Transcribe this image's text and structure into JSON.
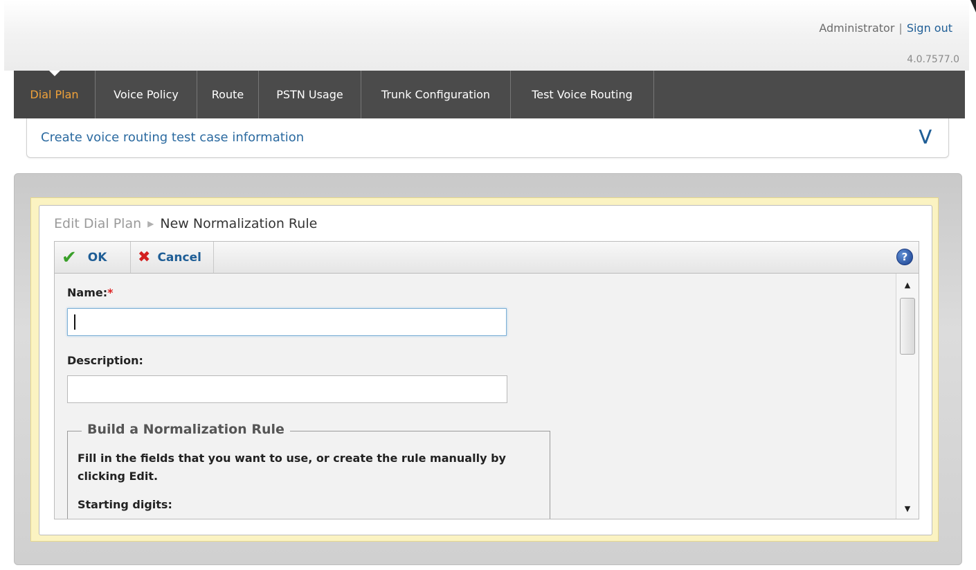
{
  "header": {
    "user": "Administrator",
    "separator": "|",
    "sign_out": "Sign out",
    "version": "4.0.7577.0"
  },
  "nav": {
    "tabs": [
      {
        "label": "Dial Plan",
        "active": true
      },
      {
        "label": "Voice Policy",
        "active": false
      },
      {
        "label": "Route",
        "active": false
      },
      {
        "label": "PSTN Usage",
        "active": false
      },
      {
        "label": "Trunk Configuration",
        "active": false
      },
      {
        "label": "Test Voice Routing",
        "active": false
      }
    ]
  },
  "infobar": {
    "text": "Create voice routing test case information",
    "expand_icon": "double-chevron-down-icon"
  },
  "breadcrumb": {
    "parent": "Edit Dial Plan",
    "current": "New Normalization Rule"
  },
  "toolbar": {
    "ok_label": "OK",
    "cancel_label": "Cancel",
    "help_icon": "help-icon"
  },
  "form": {
    "name_label": "Name:",
    "name_required": "*",
    "name_value": "",
    "description_label": "Description:",
    "description_value": "",
    "build_title": "Build a Normalization Rule",
    "build_desc": "Fill in the fields that you want to use, or create the rule manually by clicking Edit.",
    "starting_digits_label": "Starting digits:"
  },
  "colors": {
    "nav_bg": "#4b4b4b",
    "active_tab": "#f0a23a",
    "link": "#1f5e96",
    "highlight_panel": "#fbf3c2"
  }
}
